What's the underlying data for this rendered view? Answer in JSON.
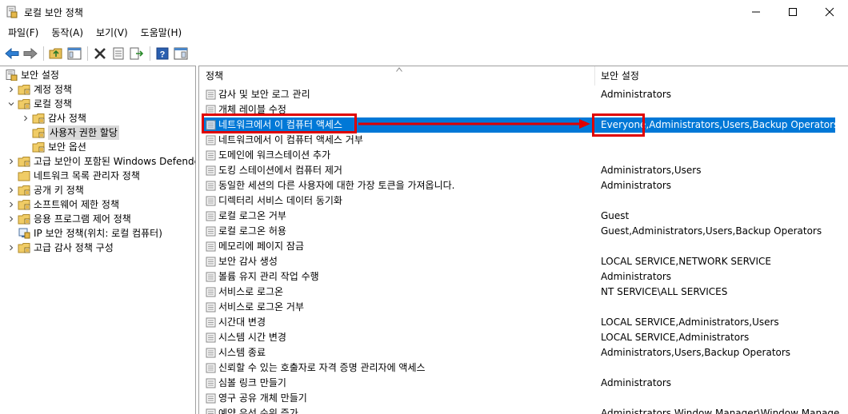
{
  "window": {
    "title": "로컬 보안 정책"
  },
  "menu": [
    "파일(F)",
    "동작(A)",
    "보기(V)",
    "도움말(H)"
  ],
  "toolbar": [
    "back-icon",
    "forward-icon",
    "up-folder-icon",
    "show-tree-icon",
    "delete-icon",
    "properties-icon",
    "export-icon",
    "help-icon",
    "console-icon"
  ],
  "tree": {
    "root": "보안 설정",
    "items": [
      {
        "label": "계정 정책",
        "level": 1,
        "expanded": false
      },
      {
        "label": "로컬 정책",
        "level": 1,
        "expanded": true
      },
      {
        "label": "감사 정책",
        "level": 2,
        "expanded": false
      },
      {
        "label": "사용자 권한 할당",
        "level": 2,
        "expanded": null,
        "selected": true
      },
      {
        "label": "보안 옵션",
        "level": 2,
        "expanded": null
      },
      {
        "label": "고급 보안이 포함된 Windows Defender",
        "level": 1,
        "expanded": false
      },
      {
        "label": "네트워크 목록 관리자 정책",
        "level": 1,
        "expanded": null
      },
      {
        "label": "공개 키 정책",
        "level": 1,
        "expanded": false
      },
      {
        "label": "소프트웨어 제한 정책",
        "level": 1,
        "expanded": false
      },
      {
        "label": "응용 프로그램 제어 정책",
        "level": 1,
        "expanded": false
      },
      {
        "label": "IP 보안 정책(위치: 로컬 컴퓨터)",
        "level": 1,
        "expanded": null
      },
      {
        "label": "고급 감사 정책 구성",
        "level": 1,
        "expanded": false
      }
    ]
  },
  "columns": {
    "policy": "정책",
    "setting": "보안 설정"
  },
  "rows": [
    {
      "policy": "감사 및 보안 로그 관리",
      "setting": "Administrators"
    },
    {
      "policy": "개체 레이블 수정",
      "setting": ""
    },
    {
      "policy": "네트워크에서 이 컴퓨터 액세스",
      "setting": "Everyone,Administrators,Users,Backup Operators",
      "highlight": true
    },
    {
      "policy": "네트워크에서 이 컴퓨터 액세스 거부",
      "setting": ""
    },
    {
      "policy": "도메인에 워크스테이션 추가",
      "setting": ""
    },
    {
      "policy": "도킹 스테이션에서 컴퓨터 제거",
      "setting": "Administrators,Users"
    },
    {
      "policy": "동일한 세션의 다른 사용자에 대한 가장 토큰을 가져옵니다.",
      "setting": "Administrators"
    },
    {
      "policy": "디렉터리 서비스 데이터 동기화",
      "setting": ""
    },
    {
      "policy": "로컬 로그온 거부",
      "setting": "Guest"
    },
    {
      "policy": "로컬 로그온 허용",
      "setting": "Guest,Administrators,Users,Backup Operators"
    },
    {
      "policy": "메모리에 페이지 잠금",
      "setting": ""
    },
    {
      "policy": "보안 감사 생성",
      "setting": "LOCAL SERVICE,NETWORK SERVICE"
    },
    {
      "policy": "볼륨 유지 관리 작업 수행",
      "setting": "Administrators"
    },
    {
      "policy": "서비스로 로그온",
      "setting": "NT SERVICE\\ALL SERVICES"
    },
    {
      "policy": "서비스로 로그온 거부",
      "setting": ""
    },
    {
      "policy": "시간대 변경",
      "setting": "LOCAL SERVICE,Administrators,Users"
    },
    {
      "policy": "시스템 시간 변경",
      "setting": "LOCAL SERVICE,Administrators"
    },
    {
      "policy": "시스템 종료",
      "setting": "Administrators,Users,Backup Operators"
    },
    {
      "policy": "신뢰할 수 있는 호출자로 자격 증명 관리자에 액세스",
      "setting": ""
    },
    {
      "policy": "심볼 링크 만들기",
      "setting": "Administrators"
    },
    {
      "policy": "영구 공유 개체 만들기",
      "setting": ""
    },
    {
      "policy": "예약 우선 순위 증가",
      "setting": "Administrators,Window Manager\\Window Manage"
    }
  ],
  "colors": {
    "highlight": "#0078d7",
    "annotation": "#e00000"
  }
}
